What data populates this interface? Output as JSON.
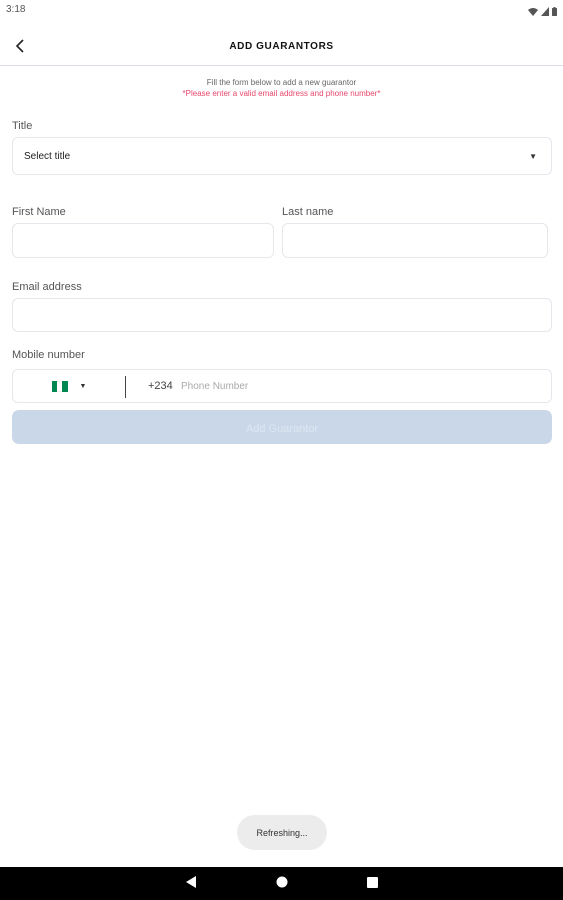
{
  "status_bar": {
    "time": "3:18",
    "icons": [
      "wifi-icon",
      "signal-icon",
      "battery-icon"
    ]
  },
  "app_bar": {
    "back_icon": "chevron-left-icon",
    "title": "ADD GUARANTORS"
  },
  "form": {
    "instruction": "Fill the form below to add a new guarantor",
    "warning": "*Please enter a valid email address and phone number*",
    "title_label": "Title",
    "title_select_value": "Select title",
    "first_name_label": "First Name",
    "first_name_value": "",
    "last_name_label": "Last name",
    "last_name_value": "",
    "email_label": "Email address",
    "email_value": "",
    "mobile_label": "Mobile number",
    "country_flag": "nigeria-flag-icon",
    "dial_code": "+234",
    "phone_placeholder": "Phone Number",
    "phone_value": "",
    "submit_label": "Add Guarantor",
    "footer_note": ""
  },
  "toast": {
    "text": "Refreshing..."
  },
  "colors": {
    "warning": "#e8476a",
    "submit_disabled": "#c9d7e8",
    "flag_green": "#008751",
    "nav_bar": "#000000"
  },
  "nav_bar": {
    "icons": [
      "back-triangle-icon",
      "home-circle-icon",
      "recents-square-icon"
    ]
  }
}
